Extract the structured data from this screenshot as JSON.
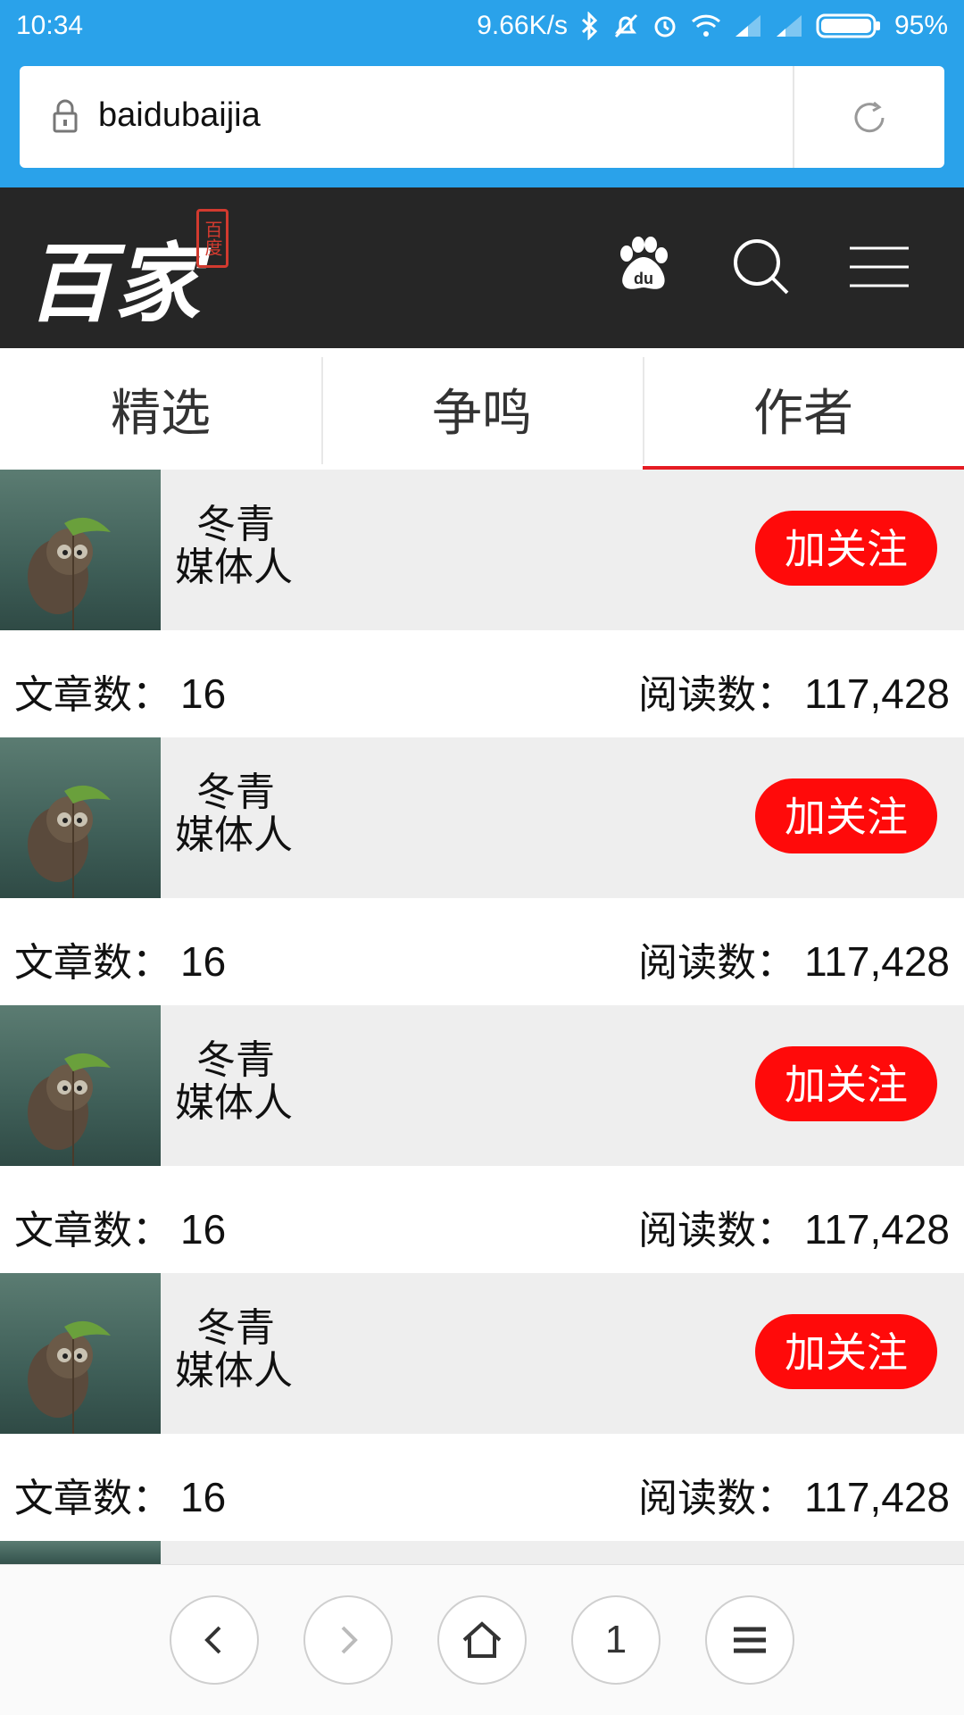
{
  "status_bar": {
    "time": "10:34",
    "speed": "9.66K/s",
    "battery": "95%",
    "icons": [
      "bluetooth-icon",
      "mute-icon",
      "alarm-icon",
      "wifi-icon",
      "signal-icon",
      "signal-icon",
      "battery-icon"
    ]
  },
  "browser": {
    "url": "baidubaijia"
  },
  "site_header": {
    "logo_text": "百家",
    "logo_seal": "百度"
  },
  "tabs": [
    {
      "label": "精选"
    },
    {
      "label": "争鸣"
    },
    {
      "label": "作者",
      "active": true
    }
  ],
  "authors": [
    {
      "name": "冬青",
      "role": "媒体人",
      "follow_label": "加关注",
      "articles_label": "文章数：",
      "articles": "16",
      "reads_label": "阅读数：",
      "reads": "117,428"
    },
    {
      "name": "冬青",
      "role": "媒体人",
      "follow_label": "加关注",
      "articles_label": "文章数：",
      "articles": "16",
      "reads_label": "阅读数：",
      "reads": "117,428"
    },
    {
      "name": "冬青",
      "role": "媒体人",
      "follow_label": "加关注",
      "articles_label": "文章数：",
      "articles": "16",
      "reads_label": "阅读数：",
      "reads": "117,428"
    },
    {
      "name": "冬青",
      "role": "媒体人",
      "follow_label": "加关注",
      "articles_label": "文章数：",
      "articles": "16",
      "reads_label": "阅读数：",
      "reads": "117,428"
    }
  ],
  "bottom_nav": {
    "tab_count": "1"
  },
  "colors": {
    "status_bar": "#2aa2ea",
    "header_bg": "#262626",
    "accent_red": "#ff0a0a",
    "tab_underline": "#e51c23"
  }
}
